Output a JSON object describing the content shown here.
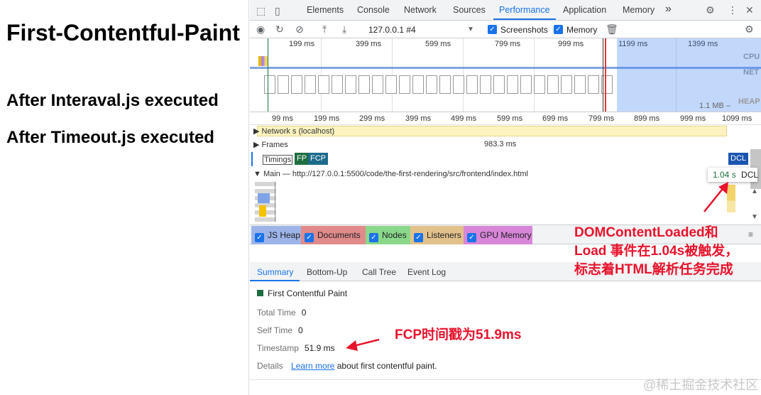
{
  "page": {
    "title": "First-Contentful-Paint",
    "heading2": "After Interaval.js executed",
    "heading3": "After Timeout.js executed"
  },
  "devtools": {
    "tabs": [
      "Elements",
      "Console",
      "Network",
      "Sources",
      "Performance",
      "Application",
      "Memory"
    ],
    "active_tab": "Performance",
    "more_tabs": "»",
    "toolbar": {
      "recording": "127.0.0.1 #4",
      "screenshots_label": "Screenshots",
      "memory_label": "Memory"
    },
    "overview": {
      "ticks": [
        "199 ms",
        "399 ms",
        "599 ms",
        "799 ms",
        "999 ms",
        "1199 ms",
        "1399 ms"
      ],
      "cpu_label": "CPU",
      "net_label": "NET",
      "heap_label": "HEAP",
      "heap_value": "1.1 MB –"
    },
    "ruler": {
      "ticks": [
        "99 ms",
        "199 ms",
        "299 ms",
        "399 ms",
        "499 ms",
        "599 ms",
        "699 ms",
        "799 ms",
        "899 ms",
        "999 ms",
        "1099 ms"
      ]
    },
    "tracks": {
      "network": "Network",
      "network_suffix": "s (localhost)",
      "frames": "Frames",
      "frames_value": "983.3 ms",
      "timings": "Timings",
      "fp": "FP",
      "fcp": "FCP",
      "dcl": "DCL",
      "dcl_tooltip_time": "1.04 s",
      "dcl_tooltip_label": "DCL",
      "main": "Main — http://127.0.0.1:5500/code/the-first-rendering/src/frontend/index.html"
    },
    "counters": [
      "JS Heap",
      "Documents",
      "Nodes",
      "Listeners",
      "GPU Memory"
    ],
    "counter_colors": [
      "#9db4e8",
      "#e08a8a",
      "#8ad88a",
      "#e3c18a",
      "#d886d8"
    ],
    "bottom_tabs": [
      "Summary",
      "Bottom-Up",
      "Call Tree",
      "Event Log"
    ],
    "active_bottom_tab": "Summary",
    "summary": {
      "event_name": "First Contentful Paint",
      "event_color": "#1e6e3f",
      "total_time_label": "Total Time",
      "total_time_value": "0",
      "self_time_label": "Self Time",
      "self_time_value": "0",
      "timestamp_label": "Timestamp",
      "timestamp_value": "51.9 ms",
      "details_label": "Details",
      "details_link": "Learn more",
      "details_text": "about first contentful paint."
    }
  },
  "annotations": {
    "dcl_note": [
      "DOMContentLoaded和",
      "Load 事件在1.04s被触发，",
      "标志着HTML解析任务完成"
    ],
    "fcp_note": "FCP时间戳为51.9ms",
    "color": "#e8132c"
  },
  "watermark": "@稀土掘金技术社区"
}
